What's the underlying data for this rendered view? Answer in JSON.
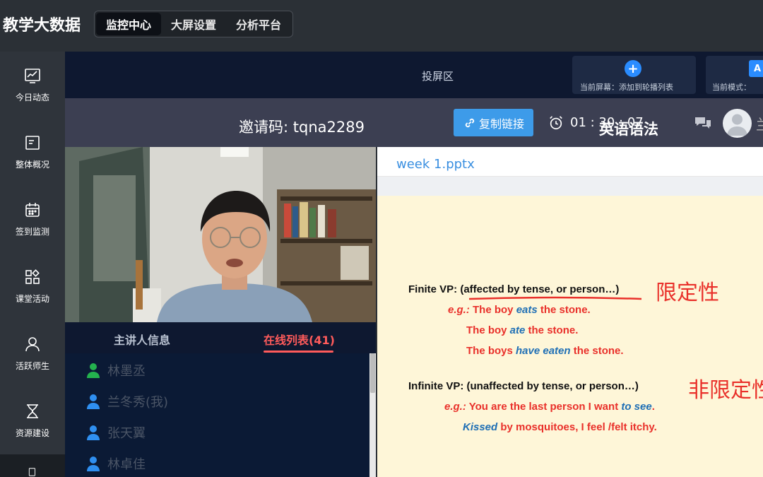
{
  "app": {
    "title": "教学大数据"
  },
  "topnav": {
    "tabs": [
      "监控中心",
      "大屏设置",
      "分析平台"
    ],
    "active": 0
  },
  "sidebar": {
    "items": [
      {
        "label": "今日动态",
        "icon": "chart-line-icon"
      },
      {
        "label": "整体概况",
        "icon": "document-icon"
      },
      {
        "label": "签到监测",
        "icon": "calendar-icon"
      },
      {
        "label": "课堂活动",
        "icon": "grid-apps-icon"
      },
      {
        "label": "活跃师生",
        "icon": "user-icon"
      },
      {
        "label": "资源建设",
        "icon": "hourglass-icon"
      }
    ]
  },
  "projection": {
    "title": "投屏区",
    "card1_label": "当前屏幕：添加到轮播列表",
    "card1_icon": "+",
    "card2_label": "当前模式：",
    "card2_icon": "A"
  },
  "meeting": {
    "invite": "邀请码:  tqna2289",
    "copy_label": "复制链接",
    "timer": "01 : 30 : 07",
    "course": "英语语法"
  },
  "panel": {
    "tab_host": "主讲人信息",
    "tab_online": "在线列表(41)",
    "people": [
      {
        "name": "林墨丞",
        "color": "#24b24e"
      },
      {
        "name": "兰冬秀(我)",
        "color": "#2f8ff0"
      },
      {
        "name": "张天翼",
        "color": "#2f8ff0"
      },
      {
        "name": "林卓佳",
        "color": "#2f8ff0"
      }
    ]
  },
  "document": {
    "name": "week 1.pptx",
    "l1": "Finite VP: (affected by tense, or person…)",
    "cn1": "限定性",
    "eg": "e.g.:",
    "l2a": "The boy ",
    "l2b": "eats",
    "l2c": " the stone.",
    "l3a": "The boy ",
    "l3b": "ate",
    "l3c": " the stone.",
    "l4a": "The boys ",
    "l4b": "have eaten",
    "l4c": " the stone.",
    "l5": "Infinite VP: (unaffected by tense, or person…)",
    "cn2": "非限定性",
    "l6a": "You are the last person I want ",
    "l6b": "to see",
    "l6c": ".",
    "l7a": "Kissed",
    "l7b": " by mosquitoes, I feel /felt itchy."
  },
  "colors": {
    "accent": "#3d9be9",
    "header_bg": "#0e1830",
    "highlight_red": "#ff5b5b"
  }
}
